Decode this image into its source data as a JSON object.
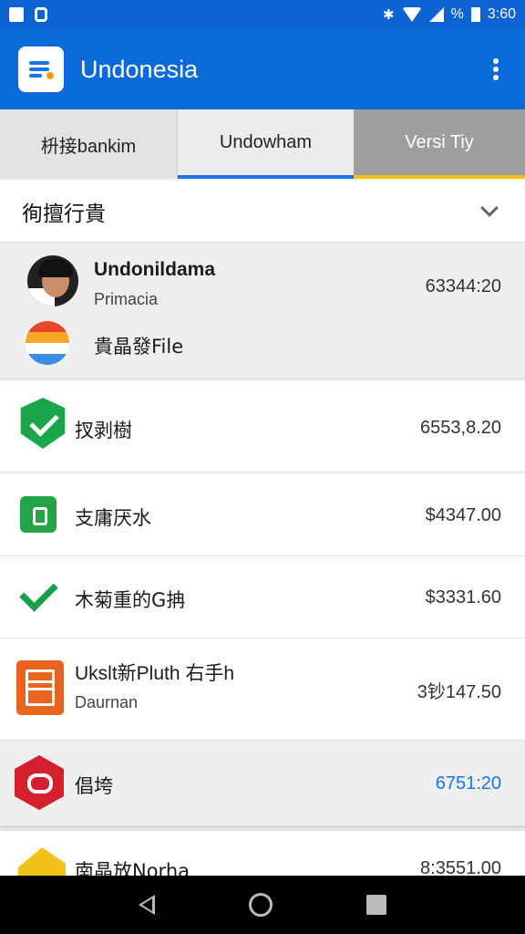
{
  "status_bar": {
    "percent_label": "%",
    "time": "3:60",
    "icons": [
      "image-icon",
      "notification-icon",
      "bluetooth-icon",
      "wifi-icon",
      "signal-icon",
      "battery-icon"
    ]
  },
  "app_bar": {
    "title": "Undonesia",
    "logo_icon": "document-logo-icon",
    "menu_icon": "more-vert-icon"
  },
  "tabs": [
    {
      "label": "枡接bankim"
    },
    {
      "label": "Undowham",
      "selected": true
    },
    {
      "label": "Versi Tiy"
    }
  ],
  "list": {
    "header": "徇擅行貴",
    "rows": [
      {
        "title": "Undonildama",
        "subtitle": "Primacia",
        "amount": "63344:20",
        "icon": "avatar"
      },
      {
        "title": "貴晶發File",
        "icon": "striped-circle-icon"
      },
      {
        "title": "扠剥樹",
        "amount": "6553,8.20",
        "icon": "green-shield-check-icon"
      },
      {
        "title": "支庸厌水",
        "amount": "$4347.00",
        "icon": "green-app-icon"
      },
      {
        "title": "木菊重的G抩",
        "amount": "$3331.60",
        "icon": "green-check-icon"
      },
      {
        "title": "Ukslt新Pluth 右手h",
        "subtitle": "Daurnan",
        "amount": "3钞147.50",
        "icon": "orange-document-icon"
      },
      {
        "title": "倡垮",
        "amount": "6751:20",
        "icon": "red-hexagon-icon",
        "amount_color": "#1a73e8"
      },
      {
        "title": "南晶放Norha",
        "amount": "8:3551.00",
        "icon": "yellow-tag-icon"
      }
    ]
  },
  "colors": {
    "app_bar": "#0b6ad9",
    "status_bar": "#0b63d4",
    "accent": "#1a73e8",
    "tab_active_indicator": "#1a73e8",
    "tab_third_indicator": "#f1c40f"
  },
  "nav_bar": {
    "icons": [
      "back-icon",
      "home-icon",
      "recents-icon"
    ]
  }
}
